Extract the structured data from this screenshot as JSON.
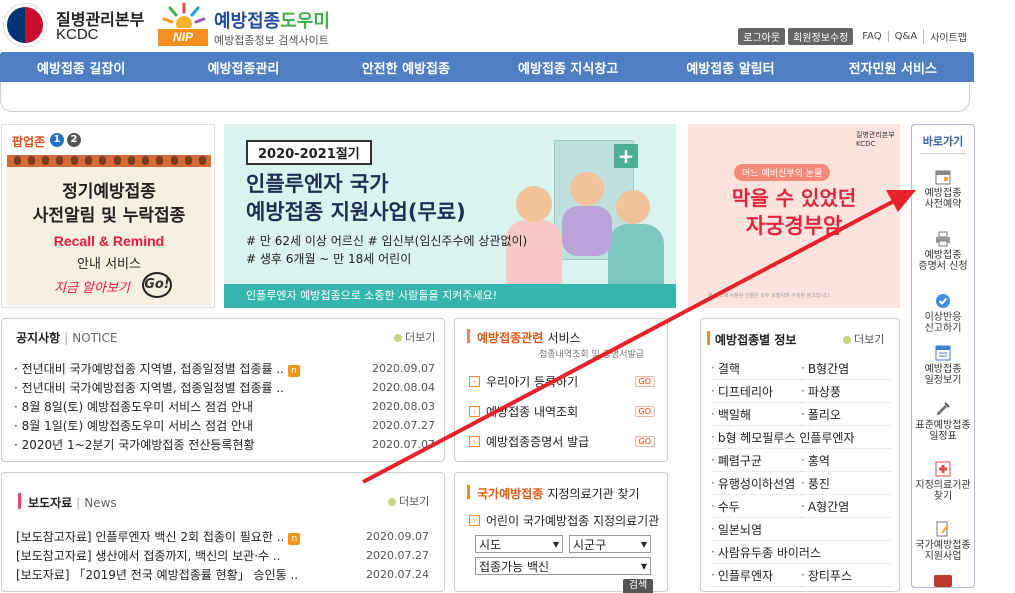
{
  "header": {
    "org_name_kr": "질병관리본부",
    "org_name_en": "KCDC",
    "site_badge": "NIP",
    "site_title_a": "예방접종",
    "site_title_b": "도우미",
    "site_subtitle": "예방접종정보 검색사이트",
    "util": {
      "logout": "로그아웃",
      "member_edit": "회원정보수정",
      "links": [
        "FAQ",
        "Q&A",
        "사이트맵"
      ]
    }
  },
  "nav": [
    "예방접종 길잡이",
    "예방접종관리",
    "안전한 예방접종",
    "예방접종 지식창고",
    "예방접종 알림터",
    "전자민원 서비스"
  ],
  "popup_zone": {
    "title": "팝업존",
    "pages": [
      "1",
      "2"
    ],
    "line1": "정기예방접종",
    "line2": "사전알림 및 누락접종",
    "line3": "Recall & Remind",
    "line4": "안내 서비스",
    "line5": "지금 알아보기",
    "go": "Go!"
  },
  "banner_flu": {
    "season": "2020-2021절기",
    "title1": "인플루엔자 국가",
    "title2": "예방접종 지원사업(무료)",
    "line1": "# 만 62세 이상 어르신 # 임신부(임신주수에 상관없이)",
    "line2": "# 생후 6개월 ~ 만 18세 어린이",
    "footer": "인플루엔자 예방접종으로 소중한 사람들을 지켜주세요!"
  },
  "banner_hpv": {
    "org": "질병관리본부 KCDC",
    "tag": "어느 예비신부의 눈물",
    "title1": "막을 수 있었던",
    "title2": "자궁경부암",
    "footer": "본 광고에 사용된 인물은 모두 모델이며 구성된 광고입니다."
  },
  "notice": {
    "title": "공지사항",
    "title_en": "NOTICE",
    "more": "더보기",
    "items": [
      {
        "text": "전년대비 국가예방접종 지역별, 접종일정별 접종률 ..",
        "date": "2020.09.07",
        "new": "n"
      },
      {
        "text": "전년대비 국가예방접종 지역별, 접종일정별 접종률 ..",
        "date": "2020.08.04",
        "new": ""
      },
      {
        "text": "8월 8일(토) 예방접종도우미 서비스 점검 안내",
        "date": "2020.08.03",
        "new": ""
      },
      {
        "text": "8월 1일(토) 예방접종도우미 서비스 점검 안내",
        "date": "2020.07.27",
        "new": ""
      },
      {
        "text": "2020년 1~2분기 국가예방접종 전산등록현황",
        "date": "2020.07.07",
        "new": ""
      }
    ]
  },
  "press": {
    "title": "보도자료",
    "title_en": "News",
    "more": "더보기",
    "items": [
      {
        "text": "[보도참고자료] 인플루엔자 백신 2회 접종이 필요한 ..",
        "date": "2020.09.07",
        "new": "n"
      },
      {
        "text": "[보도참고자료] 생산에서 접종까지, 백신의 보관·수 ..",
        "date": "2020.07.27",
        "new": ""
      },
      {
        "text": "[보도자료] 「2019년 전국 예방접종률 현황」 승인통 ..",
        "date": "2020.07.24",
        "new": ""
      }
    ]
  },
  "service": {
    "title_a": "예방접종관련",
    "title_b": "서비스",
    "sub": "접종내역조회 및 증명서발급",
    "go": "GO",
    "items": [
      "우리아기 등록하기",
      "예방접종 내역조회",
      "예방접종증명서 발급"
    ]
  },
  "hospital": {
    "title_a": "국가예방접종",
    "title_b": "지정의료기관 찾기",
    "tab": "어린이 국가예방접종 지정의료기관",
    "sel_sido": "시도",
    "sel_sigungu": "시군구",
    "sel_vaccine": "접종가능 백신",
    "search": "검색"
  },
  "vaccine_info": {
    "title": "예방접종별 정보",
    "more": "더보기",
    "items": [
      "결핵",
      "B형간염",
      "디프테리아",
      "파상풍",
      "백일해",
      "폴리오",
      "b형 헤모필루스 인플루엔자",
      "",
      "폐렴구균",
      "홍역",
      "유행성이하선염",
      "풍진",
      "수두",
      "A형간염",
      "일본뇌염",
      "",
      "사람유두종 바이러스",
      "",
      "인플루엔자",
      "장티푸스"
    ]
  },
  "quick": {
    "title": "바로가기",
    "items": [
      {
        "l1": "예방접종",
        "l2": "사전예약"
      },
      {
        "l1": "예방접종",
        "l2": "증명서 신청"
      },
      {
        "l1": "이상반응",
        "l2": "신고하기"
      },
      {
        "l1": "예방접종",
        "l2": "일정보기"
      },
      {
        "l1": "표준예방접종",
        "l2": "일정표"
      },
      {
        "l1": "지정의료기관",
        "l2": "찾기"
      },
      {
        "l1": "국가예방접종",
        "l2": "지원사업"
      }
    ]
  },
  "colors": {
    "nav_blue": "#4f7fc3",
    "accent_orange": "#f08c2a",
    "alert_red": "#e0263b",
    "arrow_red": "#e8212b"
  }
}
